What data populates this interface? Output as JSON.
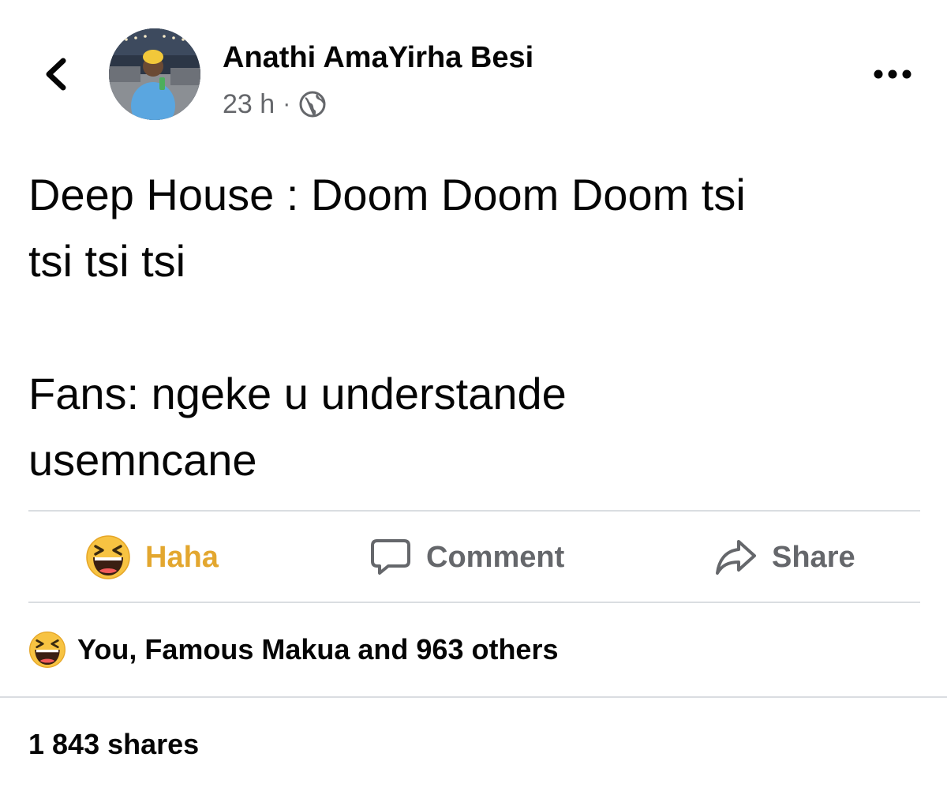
{
  "header": {
    "back_icon": "chevron-left-icon",
    "author_name": "Anathi AmaYirha Besi",
    "timestamp": "23 h",
    "separator": "·",
    "privacy_icon": "globe-icon",
    "more_icon": "more-horizontal-icon"
  },
  "post": {
    "lines": [
      "Deep House : Doom Doom Doom tsi",
      "tsi tsi tsi",
      "Fans: ngeke u understande",
      "usemncane"
    ]
  },
  "actions": {
    "haha": {
      "label": "Haha",
      "icon": "haha-emoji-icon",
      "color": "#e3a72f"
    },
    "comment": {
      "label": "Comment",
      "icon": "comment-bubble-icon"
    },
    "share": {
      "label": "Share",
      "icon": "share-arrow-icon"
    }
  },
  "reactions": {
    "icon": "haha-emoji-icon",
    "summary": "You, Famous Makua and 963 others"
  },
  "shares": {
    "label": "1 843 shares"
  },
  "colors": {
    "text_primary": "#050505",
    "text_secondary": "#65676b",
    "haha_accent": "#e3a72f",
    "divider": "#dadde1"
  }
}
